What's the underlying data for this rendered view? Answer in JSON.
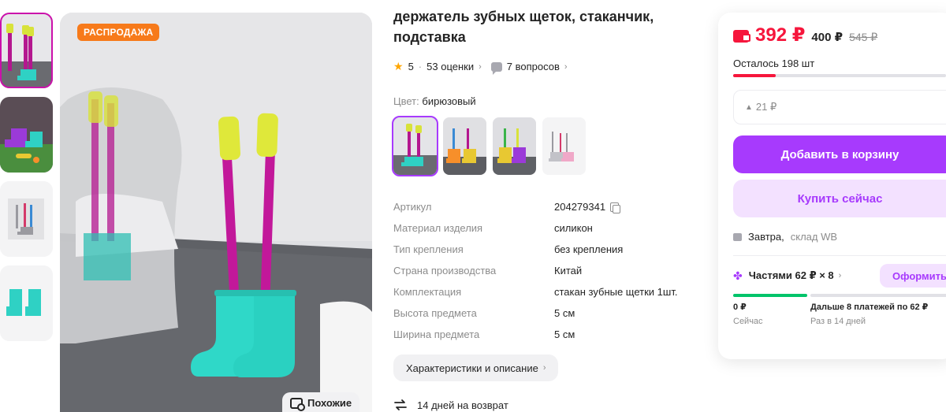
{
  "product": {
    "title": "держатель зубных щеток, стаканчик, подставка",
    "sale_badge": "РАСПРОДАЖА",
    "similar_label": "Похожие",
    "rating": "5",
    "reviews": "53 оценки",
    "questions": "7 вопросов",
    "color_label": "Цвет:",
    "color_value": "бирюзовый",
    "specs": [
      {
        "key": "Артикул",
        "value": "204279341"
      },
      {
        "key": "Материал изделия",
        "value": "силикон"
      },
      {
        "key": "Тип крепления",
        "value": "без крепления"
      },
      {
        "key": "Страна производства",
        "value": "Китай"
      },
      {
        "key": "Комплектация",
        "value": "стакан зубные щетки 1шт."
      },
      {
        "key": "Высота предмета",
        "value": "5 см"
      },
      {
        "key": "Ширина предмета",
        "value": "5 см"
      }
    ],
    "characteristics_button": "Характеристики и описание",
    "return_text": "14 дней на возврат"
  },
  "buy_card": {
    "price_wallet_label": "392 ₽",
    "price": "400 ₽",
    "old_price": "545 ₽",
    "stock_text": "Осталось 198 шт",
    "stock_fraction": 0.2,
    "discount_text": "21 ₽",
    "add_to_cart": "Добавить в корзину",
    "buy_now": "Купить сейчас",
    "delivery_when": "Завтра,",
    "delivery_where": "склад WB",
    "installments_label": "Частями 62 ₽ × 8",
    "installments_button": "Оформить",
    "installments_now_amount": "0 ₽",
    "installments_now_label": "Сейчас",
    "installments_rest_amount": "Дальше 8 платежей по 62 ₽",
    "installments_rest_label": "Раз в 14 дней"
  },
  "colors": {
    "accent": "#a73afd",
    "price_red": "#f6163c",
    "sale_orange": "#f77a1a",
    "green": "#00c46a"
  }
}
